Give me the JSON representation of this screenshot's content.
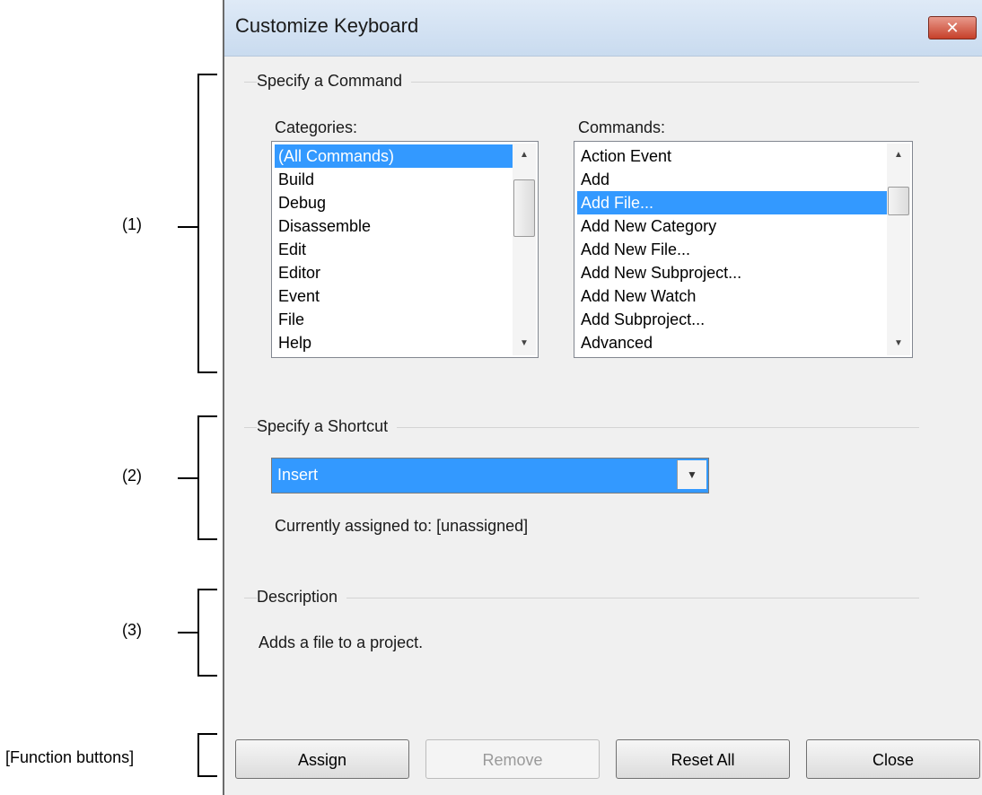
{
  "annotations": {
    "label_1": "(1)",
    "label_2": "(2)",
    "label_3": "(3)",
    "label_function_buttons": "[Function buttons]"
  },
  "dialog": {
    "title": "Customize Keyboard",
    "close_glyph": "✕"
  },
  "specify_command": {
    "group_title": "Specify a Command",
    "categories_label": "Categories:",
    "commands_label": "Commands:",
    "categories": [
      {
        "label": "(All Commands)",
        "selected": true
      },
      {
        "label": "Build",
        "selected": false
      },
      {
        "label": "Debug",
        "selected": false
      },
      {
        "label": "Disassemble",
        "selected": false
      },
      {
        "label": "Edit",
        "selected": false
      },
      {
        "label": "Editor",
        "selected": false
      },
      {
        "label": "Event",
        "selected": false
      },
      {
        "label": "File",
        "selected": false
      },
      {
        "label": "Help",
        "selected": false
      }
    ],
    "commands": [
      {
        "label": "Action Event",
        "selected": false
      },
      {
        "label": "Add",
        "selected": false
      },
      {
        "label": "Add File...",
        "selected": true
      },
      {
        "label": "Add New Category",
        "selected": false
      },
      {
        "label": "Add New File...",
        "selected": false
      },
      {
        "label": "Add New Subproject...",
        "selected": false
      },
      {
        "label": "Add New Watch",
        "selected": false
      },
      {
        "label": "Add Subproject...",
        "selected": false
      },
      {
        "label": "Advanced",
        "selected": false
      }
    ]
  },
  "specify_shortcut": {
    "group_title": "Specify a Shortcut",
    "shortcut_value": "Insert",
    "currently_assigned": "Currently assigned to: [unassigned]"
  },
  "description": {
    "group_title": "Description",
    "text": "Adds a file to a project."
  },
  "buttons": {
    "assign": "Assign",
    "remove": "Remove",
    "reset_all": "Reset All",
    "close": "Close"
  },
  "icons": {
    "scroll_up": "▲",
    "scroll_down": "▼",
    "dropdown": "▼"
  }
}
